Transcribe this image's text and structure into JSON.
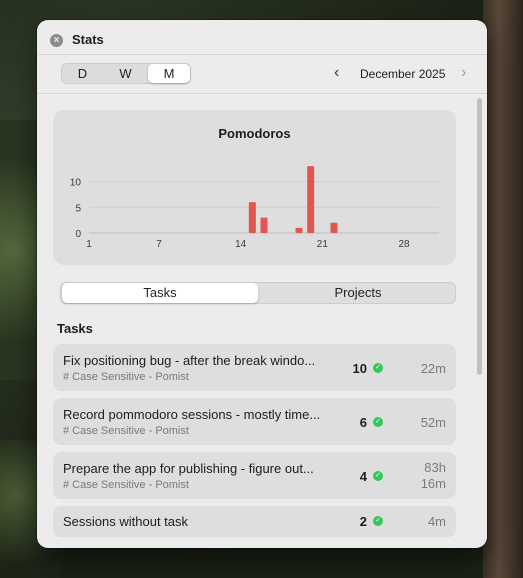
{
  "window": {
    "title": "Stats"
  },
  "period_selector": {
    "options": [
      "D",
      "W",
      "M"
    ],
    "selected": "M"
  },
  "navigation": {
    "month_label": "December 2025"
  },
  "chart_data": {
    "type": "bar",
    "title": "Pomodoros",
    "x": [
      15,
      16,
      19,
      20,
      22
    ],
    "values": [
      6,
      3,
      1,
      13,
      2
    ],
    "xlim": [
      1,
      31
    ],
    "ylim": [
      0,
      14
    ],
    "x_ticks": [
      "1",
      "7",
      "14",
      "21",
      "28"
    ],
    "y_ticks": [
      "0",
      "5",
      "10"
    ],
    "grid": true,
    "bar_color": "#e0574f"
  },
  "view_tabs": {
    "tasks_label": "Tasks",
    "projects_label": "Projects",
    "selected": "Tasks"
  },
  "tasks_section": {
    "title": "Tasks",
    "rows": [
      {
        "title": "Fix positioning bug - after the break windo...",
        "subtitle": "# Case Sensitive - Pomist",
        "count": "10",
        "time": "22m"
      },
      {
        "title": "Record pommodoro sessions - mostly time...",
        "subtitle": "# Case Sensitive - Pomist",
        "count": "6",
        "time": "52m"
      },
      {
        "title": "Prepare the app for publishing - figure out...",
        "subtitle": "# Case Sensitive - Pomist",
        "count": "4",
        "time_line1": "83h",
        "time_line2": "16m"
      },
      {
        "title": "Sessions without task",
        "count": "2",
        "time": "4m"
      }
    ]
  },
  "icons": {
    "close": "close-icon",
    "prev": "chevron-left-icon",
    "next": "chevron-right-icon",
    "check": "checkmark-circle-icon"
  },
  "colors": {
    "accent_green": "#34c759",
    "bar_red": "#e0574f"
  }
}
